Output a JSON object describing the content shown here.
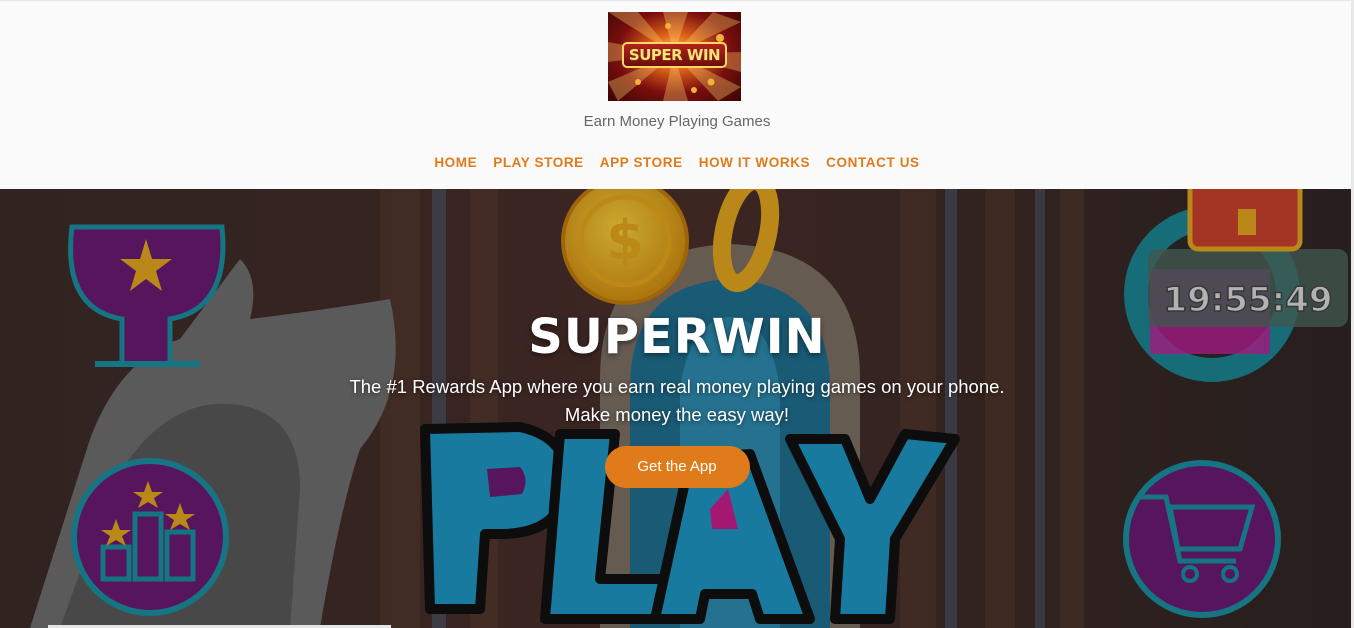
{
  "brand": {
    "logo_text": "SUPER WIN",
    "tagline": "Earn Money Playing Games"
  },
  "nav": {
    "items": [
      {
        "label": "HOME"
      },
      {
        "label": "PLAY STORE"
      },
      {
        "label": "APP STORE"
      },
      {
        "label": "HOW IT WORKS"
      },
      {
        "label": "CONTACT US"
      }
    ]
  },
  "hero": {
    "title": "SUPERWIN",
    "line1": "The #1 Rewards App where you earn real money playing games on your phone.",
    "line2": "Make money the easy way!",
    "cta_label": "Get the App",
    "timer_text": "19:55:49",
    "coin_symbol": "$",
    "play_text": "PLAY"
  },
  "colors": {
    "accent": "#e07b1c",
    "tagline": "#666666",
    "teal": "#1a8fa0",
    "purple": "#6b1a73"
  },
  "icons": [
    "trophy-icon",
    "leaderboard-icon",
    "shopping-cart-icon",
    "gear-icon",
    "treasure-chest-icon",
    "coin-icon"
  ]
}
